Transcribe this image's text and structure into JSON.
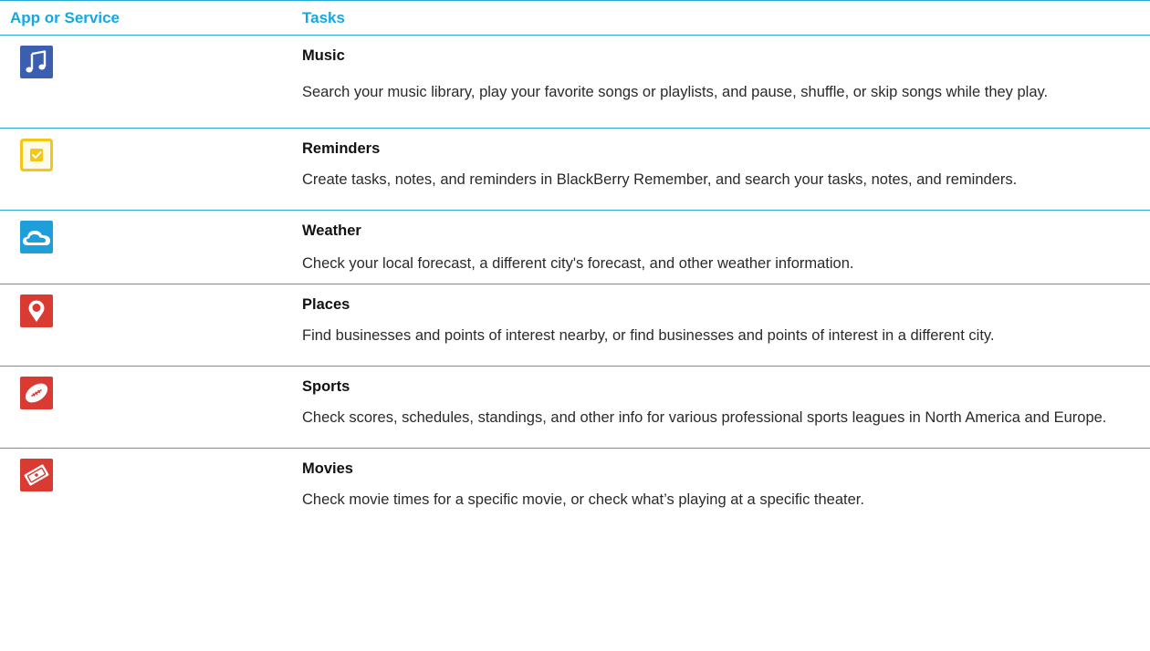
{
  "header": {
    "col1": "App or Service",
    "col2": "Tasks"
  },
  "colors": {
    "accent": "#16a7dd",
    "rule": "#29a9d6"
  },
  "rows": [
    {
      "icon": "music-note-icon",
      "title": "Music",
      "description": "Search your music library, play your favorite songs or playlists, and pause, shuffle, or skip songs while they play."
    },
    {
      "icon": "reminders-checkbox-icon",
      "title": "Reminders",
      "description": "Create tasks, notes, and reminders in BlackBerry Remember, and search your tasks, notes, and reminders."
    },
    {
      "icon": "weather-cloud-icon",
      "title": "Weather",
      "description": "Check your local forecast, a different city's forecast, and other weather information."
    },
    {
      "icon": "map-pin-icon",
      "title": "Places",
      "description": "Find businesses and points of interest nearby, or find businesses and points of interest in a different city."
    },
    {
      "icon": "football-icon",
      "title": "Sports",
      "description": "Check scores, schedules, standings, and other info for various professional sports leagues in North America and Europe."
    },
    {
      "icon": "movie-ticket-icon",
      "title": "Movies",
      "description": "Check movie times for a specific movie, or check what’s playing at a specific theater."
    }
  ]
}
